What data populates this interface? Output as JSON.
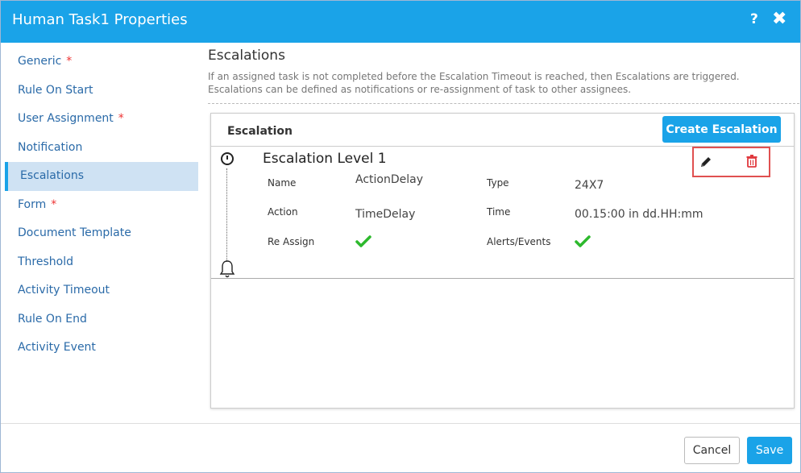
{
  "window": {
    "title": "Human Task1 Properties",
    "help_label": "?",
    "close_label": "✖"
  },
  "sidebar": {
    "items": [
      {
        "label": "Generic",
        "required": "*"
      },
      {
        "label": "Rule On Start",
        "required": ""
      },
      {
        "label": "User Assignment",
        "required": "*"
      },
      {
        "label": "Notification",
        "required": ""
      },
      {
        "label": "Escalations",
        "required": "",
        "active": true
      },
      {
        "label": "Form",
        "required": "*"
      },
      {
        "label": "Document Template",
        "required": ""
      },
      {
        "label": "Threshold",
        "required": ""
      },
      {
        "label": "Activity Timeout",
        "required": ""
      },
      {
        "label": "Rule On End",
        "required": ""
      },
      {
        "label": "Activity Event",
        "required": ""
      }
    ]
  },
  "main": {
    "heading": "Escalations",
    "description": "If an assigned task is not completed before the Escalation Timeout is reached, then Escalations are triggered. Escalations can be defined as notifications or re-assignment of task to other assignees."
  },
  "panel": {
    "title": "Escalation",
    "create_button": "Create Escalation",
    "level": {
      "title": "Escalation Level 1",
      "name_label": "Name",
      "name_value": "ActionDelay",
      "type_label": "Type",
      "type_value": "24X7",
      "action_label": "Action",
      "action_value": "TimeDelay",
      "time_label": "Time",
      "time_value": "00.15:00 in dd.HH:mm",
      "reassign_label": "Re Assign",
      "reassign_checked": true,
      "alerts_label": "Alerts/Events",
      "alerts_checked": true
    }
  },
  "footer": {
    "cancel_label": "Cancel",
    "save_label": "Save"
  },
  "colors": {
    "accent": "#1aa3e8",
    "check": "#2db92d",
    "delete": "#e0393e",
    "highlight_box": "#e05050"
  },
  "icons": [
    "clock-icon",
    "bell-icon",
    "pencil-icon",
    "trash-icon",
    "check-icon"
  ]
}
